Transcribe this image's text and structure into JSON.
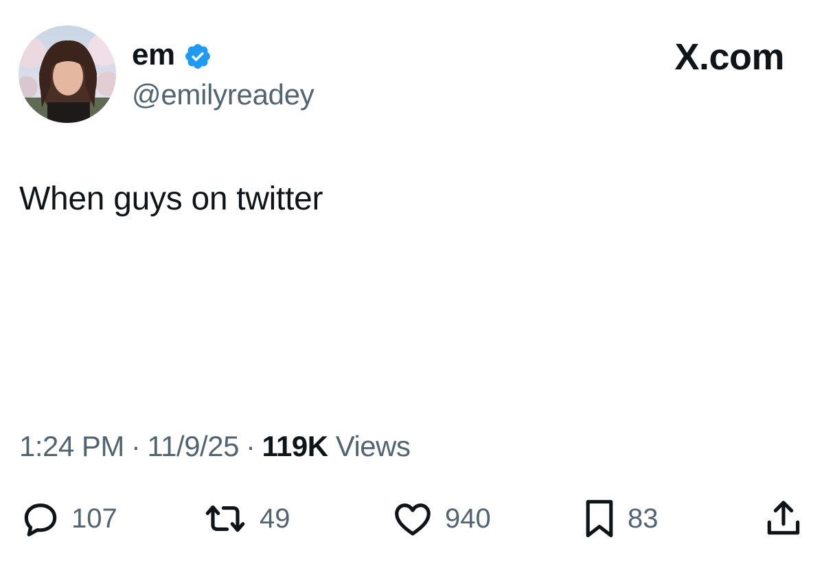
{
  "author": {
    "display_name": "em",
    "handle": "@emilyreadey",
    "verified": true,
    "verified_color": "#1d9bf0"
  },
  "brand": "X.com",
  "tweet": {
    "text": "When guys on twitter",
    "time": "1:24 PM",
    "date": "11/9/25",
    "views_count": "119K",
    "views_label": "Views"
  },
  "actions": {
    "replies": "107",
    "reposts": "49",
    "likes": "940",
    "bookmarks": "83"
  },
  "icons": {
    "reply": "reply-bubble-icon",
    "repost": "repost-arrows-icon",
    "like": "heart-icon",
    "bookmark": "bookmark-icon",
    "share": "share-upload-icon"
  },
  "colors": {
    "text_primary": "#0f1419",
    "text_secondary": "#536471",
    "background": "#ffffff"
  }
}
